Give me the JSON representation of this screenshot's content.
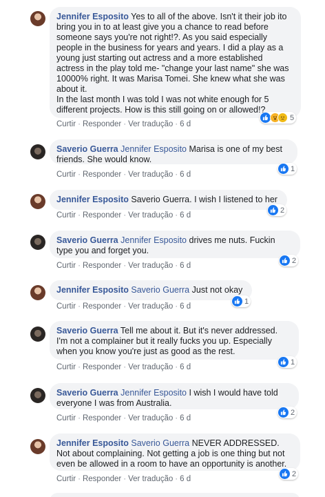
{
  "actions": {
    "like": "Curtir",
    "reply": "Responder",
    "translation": "Ver tradução",
    "sep": "·"
  },
  "comments": [
    {
      "author": "Jennifer Esposito",
      "mention": "",
      "text": "Yes to all of the above. Isn't it their job ito\nbring you in to at least give you a chance to read before\nsomeone says you're not right!?. As you said especially\npeople in the business for years and years. I did a play as a\nyoung just starting out actress and a more established\nactress in the play told me- \"change your last name\" she was\n10000% right. It was Marisa Tomei. She knew what she was\nabout it.\nIn the last month I was told I was not white enough for 5\ndifferent projects. How is this still going on or allowed!?",
      "time": "6 d",
      "reactions": "5",
      "reaction_icons": [
        "like-icon",
        "wow-icon",
        "sad-icon"
      ]
    },
    {
      "author": "Saverio Guerra",
      "mention": "Jennifer Esposito",
      "text": " Marisa is one of my best\nfriends. She would know.",
      "time": "6 d",
      "reactions": "1"
    },
    {
      "author": "Jennifer Esposito",
      "mention": "",
      "text": "Saverio Guerra. I wish I listened to her",
      "time": "6 d",
      "reactions": "2"
    },
    {
      "author": "Saverio Guerra",
      "mention": "Jennifer Esposito",
      "text": " drives me nuts. Fuckin\ntype you and forget you.",
      "time": "6 d",
      "reactions": "2"
    },
    {
      "author": "Jennifer Esposito",
      "mention": "Saverio Guerra",
      "text": " Just not okay",
      "time": "6 d",
      "reactions": "1"
    },
    {
      "author": "Saverio Guerra",
      "mention": "",
      "text": "Tell me about it. But it's never addressed.\nI'm not a complainer but it really fucks you up. Especially\nwhen you know you're just as good as the rest.",
      "time": "6 d",
      "reactions": "1"
    },
    {
      "author": "Saverio Guerra",
      "mention": "Jennifer Esposito",
      "text": " I wish I would have told\neveryone I was from Australia.",
      "time": "6 d",
      "reactions": "2"
    },
    {
      "author": "Jennifer Esposito",
      "mention": "Saverio Guerra",
      "text": " NEVER ADDRESSED.\nNot about complaining. Not getting a job is one thing but not\neven be allowed in a room to have an opportunity is another.",
      "time": "6 d",
      "reactions": "2"
    }
  ]
}
